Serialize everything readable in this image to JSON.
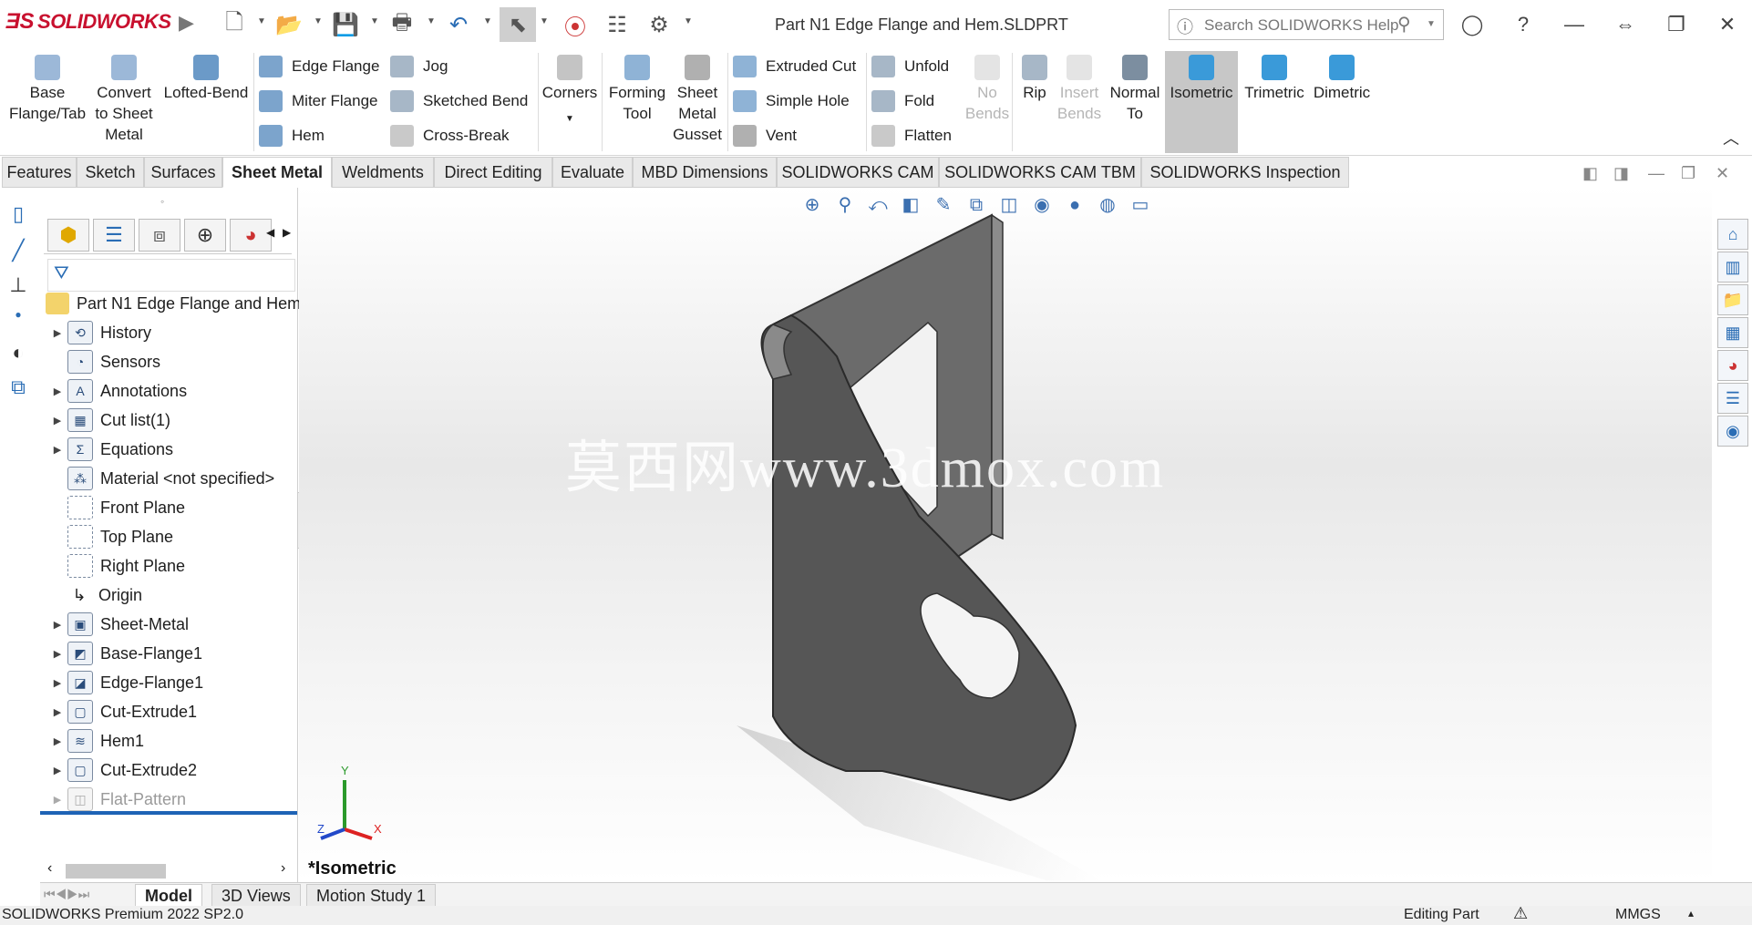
{
  "app": {
    "name": "SOLIDWORKS",
    "document_title": "Part N1 Edge Flange and Hem.SLDPRT"
  },
  "search": {
    "placeholder": "Search SOLIDWORKS Help"
  },
  "commands": {
    "base_flange": "Base\nFlange/Tab",
    "convert": "Convert\nto Sheet\nMetal",
    "lofted": "Lofted-Bend",
    "edge_flange": "Edge Flange",
    "miter_flange": "Miter Flange",
    "hem": "Hem",
    "jog": "Jog",
    "sketched_bend": "Sketched Bend",
    "cross_break": "Cross-Break",
    "corners": "Corners",
    "forming_tool": "Forming\nTool",
    "gusset": "Sheet\nMetal\nGusset",
    "extruded_cut": "Extruded Cut",
    "simple_hole": "Simple Hole",
    "vent": "Vent",
    "unfold": "Unfold",
    "fold": "Fold",
    "flatten": "Flatten",
    "no_bends": "No\nBends",
    "rip": "Rip",
    "insert_bends": "Insert\nBends",
    "normal_to": "Normal\nTo",
    "isometric": "Isometric",
    "trimetric": "Trimetric",
    "dimetric": "Dimetric"
  },
  "tabs": [
    "Features",
    "Sketch",
    "Surfaces",
    "Sheet Metal",
    "Weldments",
    "Direct Editing",
    "Evaluate",
    "MBD Dimensions",
    "SOLIDWORKS CAM",
    "SOLIDWORKS CAM TBM",
    "SOLIDWORKS Inspection"
  ],
  "tree": {
    "root": "Part N1 Edge Flange and Hem",
    "items": [
      "History",
      "Sensors",
      "Annotations",
      "Cut list(1)",
      "Equations",
      "Material <not specified>",
      "Front Plane",
      "Top Plane",
      "Right Plane",
      "Origin",
      "Sheet-Metal",
      "Base-Flange1",
      "Edge-Flange1",
      "Cut-Extrude1",
      "Hem1",
      "Cut-Extrude2",
      "Flat-Pattern"
    ]
  },
  "viewport": {
    "watermark": "莫西网www.3dmox.com",
    "view_name": "*Isometric",
    "triad": {
      "x": "X",
      "y": "Y",
      "z": "Z"
    }
  },
  "bottom_tabs": [
    "Model",
    "3D Views",
    "Motion Study 1"
  ],
  "status": {
    "left": "SOLIDWORKS Premium 2022 SP2.0",
    "mode": "Editing Part",
    "units": "MMGS"
  }
}
